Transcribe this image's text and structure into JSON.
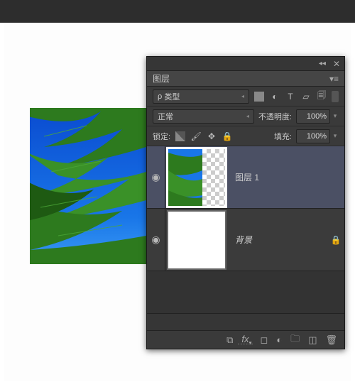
{
  "panel": {
    "title": "图层",
    "filter_label": "类型",
    "blend_mode": "正常",
    "opacity_label": "不透明度:",
    "opacity_value": "100%",
    "lock_label": "锁定:",
    "fill_label": "填充:",
    "fill_value": "100%"
  },
  "layers": [
    {
      "name": "图层 1",
      "visible": true,
      "selected": true,
      "locked": false
    },
    {
      "name": "背景",
      "visible": true,
      "selected": false,
      "locked": true
    }
  ],
  "icons": {
    "search": "🔍",
    "image_filter": "▣",
    "adjust_filter": "◐",
    "type_filter": "T",
    "shape_filter": "▱",
    "smart_filter": "🗎",
    "lock_position": "✥",
    "lock_all": "🔒",
    "eye": "◉",
    "link": "⧉",
    "fx": "fx",
    "mask": "◯",
    "adjustment": "◐",
    "group": "🗀",
    "new": "◫",
    "trash": "🗑"
  }
}
